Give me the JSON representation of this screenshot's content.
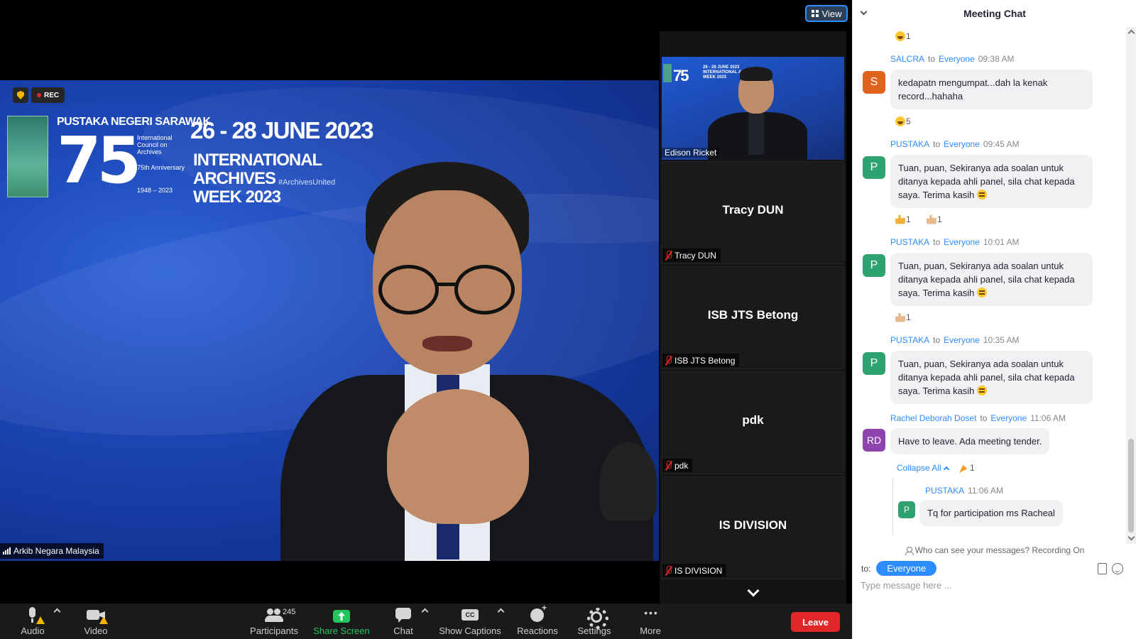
{
  "view_button": {
    "label": "View"
  },
  "recording": {
    "label": "REC"
  },
  "banner": {
    "org": "PUSTAKA NEGERI SARAWAK",
    "anniversary_number": "75",
    "small1": "International Council on Archives",
    "small2": "75th Anniversary",
    "small3": "1948 – 2023",
    "dates": "26 - 28 JUNE 2023",
    "event_line1": "INTERNATIONAL ARCHIVES",
    "event_line2": "WEEK 2023",
    "hashtag": "#ArchivesUnited"
  },
  "active_speaker": {
    "name": "Arkib Negara Malaysia"
  },
  "gallery": {
    "video_tile": {
      "name": "Edison Ricket",
      "mini_line1": "26 - 28 JUNE 2023",
      "mini_line2": "INTERNATIONAL ARCHIVES",
      "mini_line3": "WEEK 2023",
      "mini_75": "75"
    },
    "tiles": [
      {
        "name": "Tracy DUN",
        "label": "Tracy DUN"
      },
      {
        "name": "ISB JTS Betong",
        "label": "ISB JTS Betong"
      },
      {
        "name": "pdk",
        "label": "pdk"
      },
      {
        "name": "IS DIVISION",
        "label": "IS DIVISION"
      }
    ]
  },
  "toolbar": {
    "audio": "Audio",
    "video": "Video",
    "participants": "Participants",
    "participants_count": "245",
    "share_screen": "Share Screen",
    "chat": "Chat",
    "show_captions": "Show Captions",
    "cc": "CC",
    "reactions": "Reactions",
    "settings": "Settings",
    "more": "More",
    "leave": "Leave"
  },
  "chat": {
    "title": "Meeting Chat",
    "reaction_top": "1",
    "messages": [
      {
        "sender": "SALCRA",
        "to_word": "to",
        "recipient": "Everyone",
        "time": "09:38 AM",
        "avatar": "S",
        "avatar_color": "#e0641e",
        "line1": "kedapatn mengumpat...dah la kenak",
        "line2": "record...hahaha",
        "reaction": "5"
      },
      {
        "sender": "PUSTAKA",
        "to_word": "to",
        "recipient": "Everyone",
        "time": "09:45 AM",
        "avatar": "P",
        "avatar_color": "#2ea26f",
        "line1": "Tuan, puan, Sekiranya ada soalan untuk",
        "line2": "ditanya kepada ahli panel, sila chat kepada",
        "line3": "saya. Terima kasih",
        "reaction_a": "1",
        "reaction_b": "1"
      },
      {
        "sender": "PUSTAKA",
        "to_word": "to",
        "recipient": "Everyone",
        "time": "10:01 AM",
        "avatar": "P",
        "avatar_color": "#2ea26f",
        "line1": "Tuan, puan, Sekiranya ada soalan untuk",
        "line2": "ditanya kepada ahli panel, sila chat kepada",
        "line3": "saya. Terima kasih",
        "reaction": "1"
      },
      {
        "sender": "PUSTAKA",
        "to_word": "to",
        "recipient": "Everyone",
        "time": "10:35 AM",
        "avatar": "P",
        "avatar_color": "#2ea26f",
        "line1": "Tuan, puan, Sekiranya ada soalan untuk",
        "line2": "ditanya kepada ahli panel, sila chat kepada",
        "line3": "saya. Terima kasih"
      },
      {
        "sender": "Rachel Deborah Doset",
        "to_word": "to",
        "recipient": "Everyone",
        "time": "11:06 AM",
        "avatar": "RD",
        "avatar_color": "#8e44ad",
        "line1": "Have to leave. Ada meeting tender."
      }
    ],
    "collapse_label": "Collapse All",
    "collapse_reaction": "1",
    "reply": {
      "sender": "PUSTAKA",
      "time": "11:06 AM",
      "avatar": "P",
      "avatar_color": "#2ea26f",
      "text": "Tq for participation ms Racheal"
    },
    "footer_note": "Who can see your messages? Recording On",
    "to_label": "to:",
    "to_value": "Everyone",
    "input_placeholder": "Type message here ..."
  }
}
